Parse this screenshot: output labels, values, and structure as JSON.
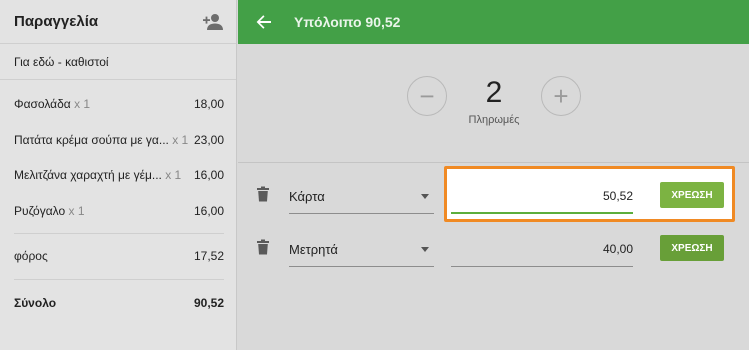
{
  "order": {
    "title": "Παραγγελία",
    "mode": "Για εδώ - καθιστοί",
    "items": [
      {
        "name": "Φασολάδα",
        "qty": "x 1",
        "price": "18,00"
      },
      {
        "name": "Πατάτα κρέμα σούπα με γα...",
        "qty": "x 1",
        "price": "23,00"
      },
      {
        "name": "Μελιτζάνα χαραχτή με γέμ...",
        "qty": "x 1",
        "price": "16,00"
      },
      {
        "name": "Ρυζόγαλο",
        "qty": "x 1",
        "price": "16,00"
      }
    ],
    "tax": {
      "label": "φόρος",
      "value": "17,52"
    },
    "total": {
      "label": "Σύνολο",
      "value": "90,52"
    }
  },
  "header": {
    "title": "Υπόλοιπο 90,52"
  },
  "payments_counter": {
    "count": "2",
    "label": "Πληρωμές",
    "minus": "−",
    "plus": "+"
  },
  "payments": [
    {
      "method": "Κάρτα",
      "amount": "50,52",
      "charge_label": "ΧΡΕΩΣΗ"
    },
    {
      "method": "Μετρητά",
      "amount": "40,00",
      "charge_label": "ΧΡΕΩΣΗ"
    }
  ],
  "colors": {
    "topbar": "#43a047",
    "charge_active": "#7cb342",
    "charge_inactive": "#689f38",
    "highlight": "#f08a24"
  },
  "icons": {
    "back": "arrow-left",
    "add_person": "person-add",
    "delete": "trash"
  }
}
